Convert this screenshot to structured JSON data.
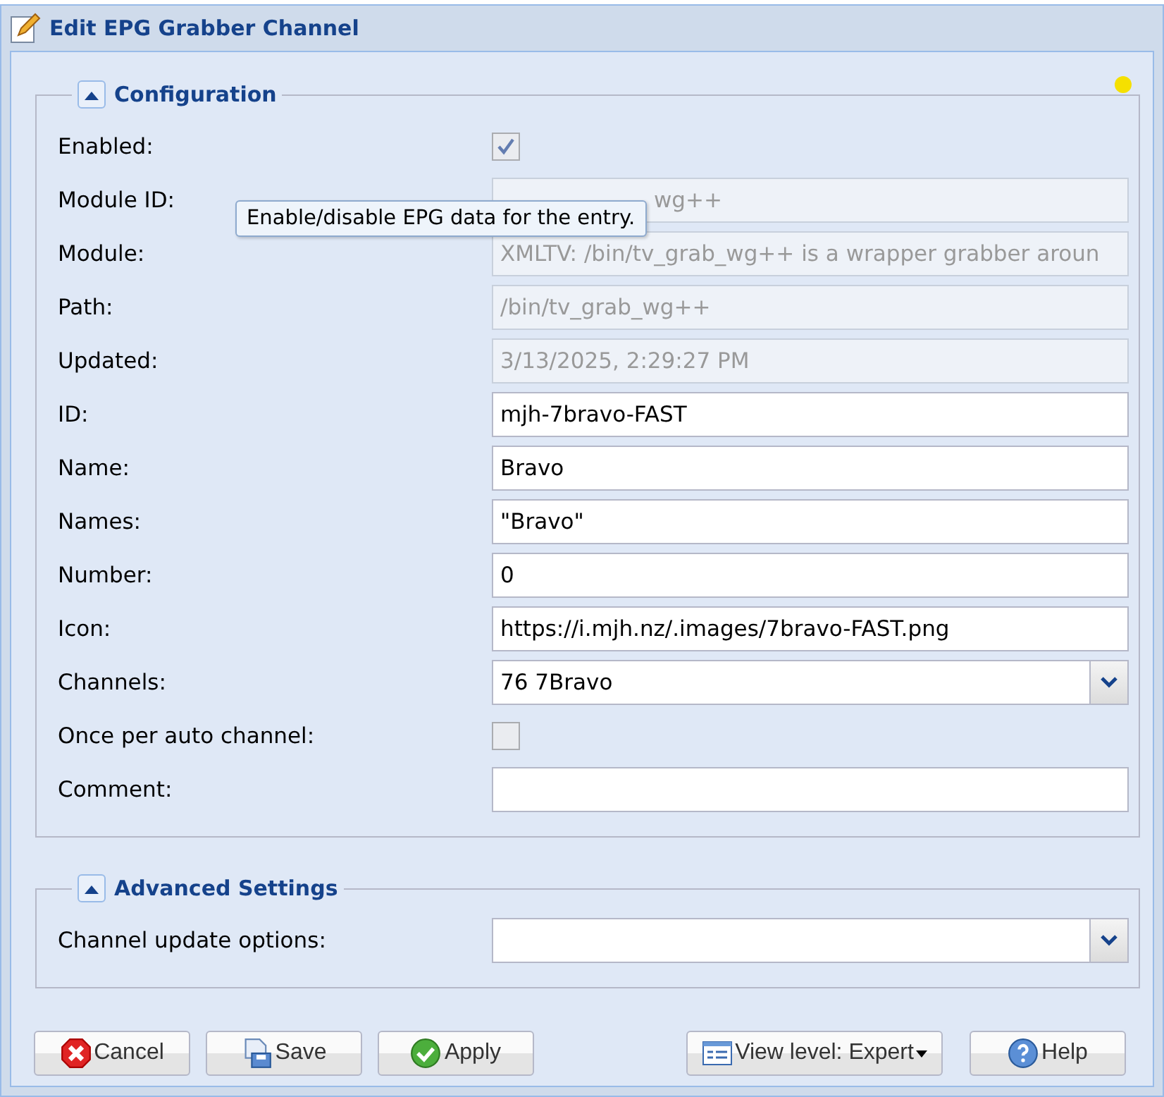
{
  "window": {
    "title": "Edit EPG Grabber Channel"
  },
  "sections": [
    {
      "title": "Configuration",
      "expanded": true,
      "fields": [
        {
          "label": "Enabled:",
          "kind": "checkbox",
          "checked": true,
          "disabled": true
        },
        {
          "label": "Module ID:",
          "kind": "text",
          "value": "wg++",
          "disabled": true,
          "obscured": true
        },
        {
          "label": "Module:",
          "kind": "text",
          "value": "XMLTV: /bin/tv_grab_wg++ is a wrapper grabber aroun",
          "disabled": true
        },
        {
          "label": "Path:",
          "kind": "text",
          "value": "/bin/tv_grab_wg++",
          "disabled": true
        },
        {
          "label": "Updated:",
          "kind": "text",
          "value": "3/13/2025, 2:29:27 PM",
          "disabled": true
        },
        {
          "label": "ID:",
          "kind": "text",
          "value": "mjh-7bravo-FAST",
          "disabled": false
        },
        {
          "label": "Name:",
          "kind": "text",
          "value": "Bravo",
          "disabled": false
        },
        {
          "label": "Names:",
          "kind": "text",
          "value": "\"Bravo\"",
          "disabled": false
        },
        {
          "label": "Number:",
          "kind": "text",
          "value": "0",
          "disabled": false
        },
        {
          "label": "Icon:",
          "kind": "text",
          "value": "https://i.mjh.nz/.images/7bravo-FAST.png",
          "disabled": false
        },
        {
          "label": "Channels:",
          "kind": "combo",
          "value": "76 7Bravo",
          "disabled": false
        },
        {
          "label": "Once per auto channel:",
          "kind": "checkbox",
          "checked": false,
          "disabled": true
        },
        {
          "label": "Comment:",
          "kind": "text",
          "disabled": false
        }
      ]
    },
    {
      "title": "Advanced Settings",
      "expanded": true,
      "fields": [
        {
          "label": "Channel update options:",
          "kind": "combo",
          "disabled": false
        }
      ]
    }
  ],
  "tooltip": "Enable/disable EPG data for the entry.",
  "buttons": [
    {
      "label": "Cancel",
      "kind": "cancel"
    },
    {
      "label": "Save",
      "kind": "save"
    },
    {
      "label": "Apply",
      "kind": "apply"
    },
    {
      "label": "View level: Expert",
      "kind": "menu"
    },
    {
      "label": "Help",
      "kind": "help"
    }
  ]
}
